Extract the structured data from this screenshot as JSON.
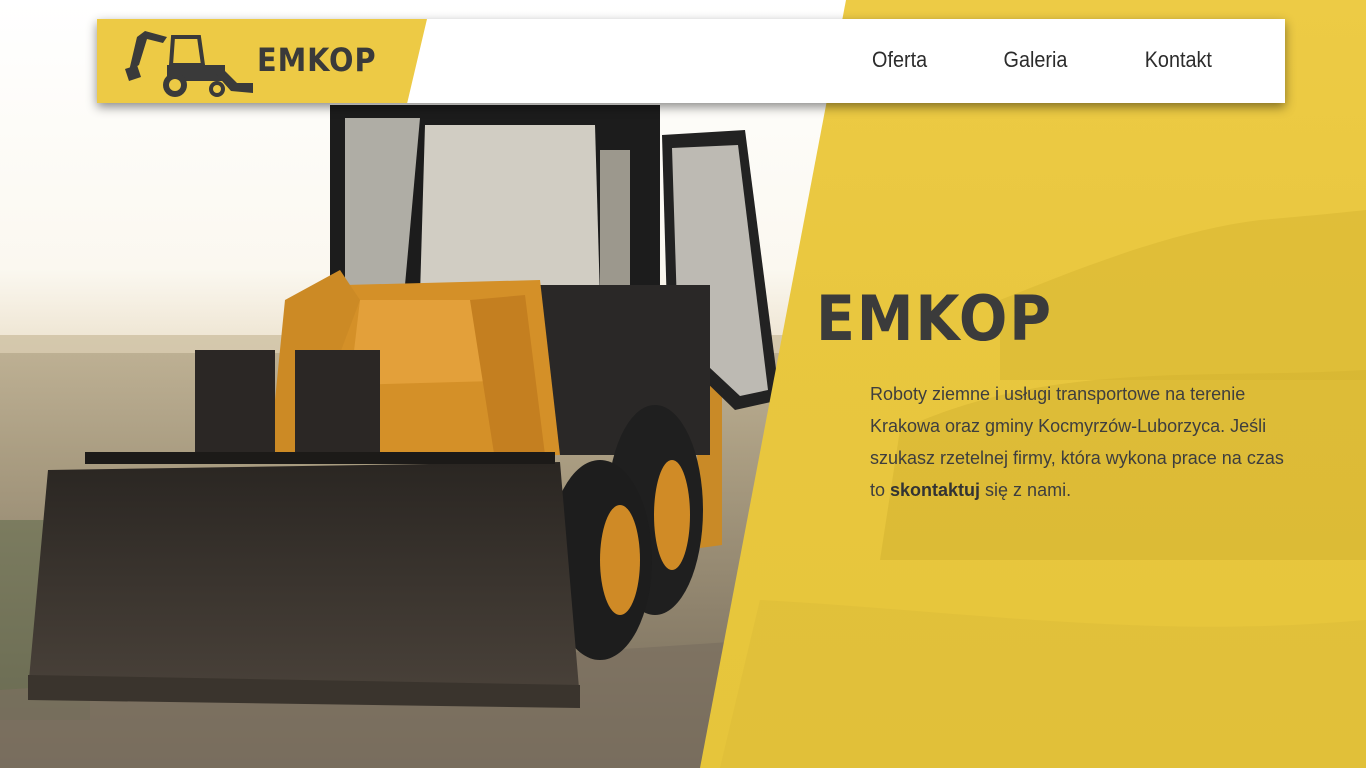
{
  "brand": {
    "name": "EMKOP",
    "logo_icon": "backhoe-loader-icon"
  },
  "nav": {
    "items": [
      {
        "label": "Oferta"
      },
      {
        "label": "Galeria"
      },
      {
        "label": "Kontakt"
      }
    ]
  },
  "hero": {
    "title": "EMKOP",
    "description_before": "Roboty ziemne i usługi transportowe na terenie Krakowa oraz gminy Kocmyrzów-Luborzyca. Jeśli szukasz rzetelnej firmy, która wykona prace na czas to ",
    "description_link": "skontaktuj",
    "description_after": " się z nami.",
    "photo": "backhoe-loader-in-field-photo"
  },
  "colors": {
    "accent_yellow": "#edca45",
    "text_dark": "#3b3b3b",
    "header_bg": "#ffffff"
  }
}
